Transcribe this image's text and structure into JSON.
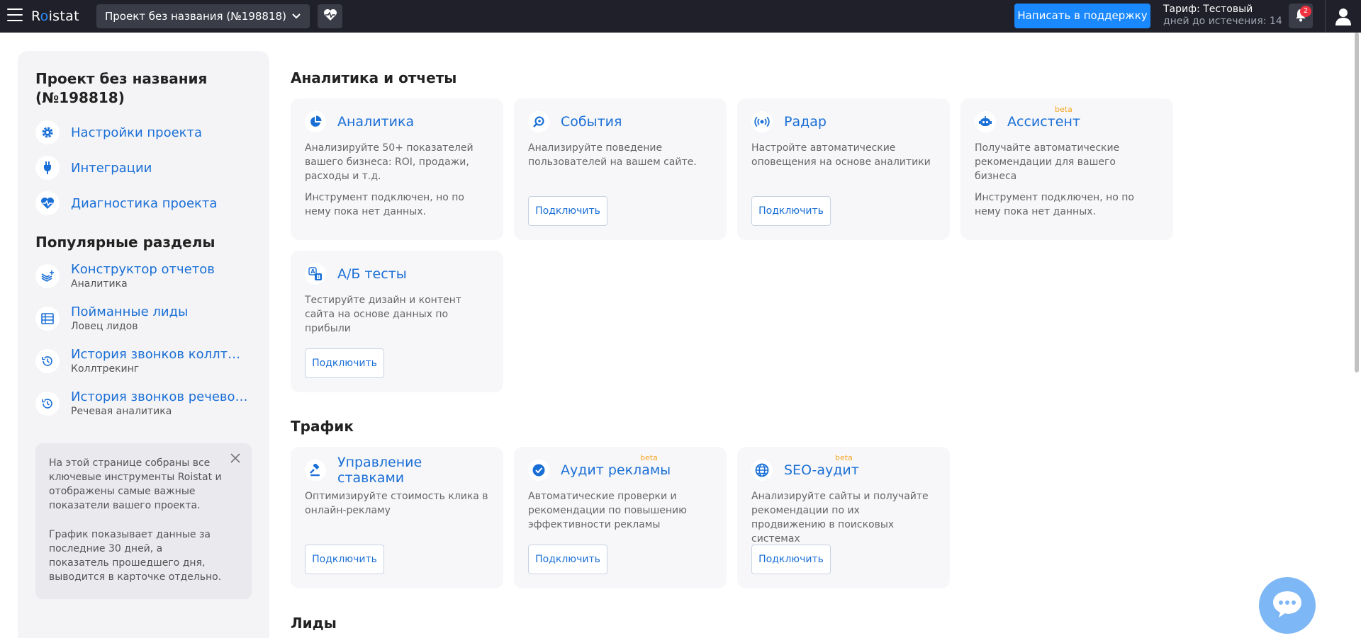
{
  "topbar": {
    "logo": "Roistat",
    "logo_prefix": "R",
    "logo_o": "o",
    "logo_suffix": "istat",
    "project_name": "Проект без названия (№198818)",
    "support_label": "Написать в поддержку",
    "tariff_label": "Тариф: Тестовый",
    "tariff_days": "дней до истечения: 14",
    "notifications_count": "2",
    "accent_color": "#1a88ff"
  },
  "sidebar": {
    "project_title": "Проект без названия (№198818)",
    "links": [
      {
        "label": "Настройки проекта",
        "icon": "gear-icon"
      },
      {
        "label": "Интеграции",
        "icon": "plug-icon"
      },
      {
        "label": "Диагностика проекта",
        "icon": "heart-pulse-icon"
      }
    ],
    "popular_title": "Популярные разделы",
    "popular": [
      {
        "label": "Конструктор отчетов",
        "sub": "Аналитика",
        "icon": "layers-plus-icon"
      },
      {
        "label": "Пойманные лиды",
        "sub": "Ловец лидов",
        "icon": "table-icon"
      },
      {
        "label": "История звонков коллтрекинга",
        "sub": "Коллтрекинг",
        "icon": "history-icon"
      },
      {
        "label": "История звонков речевой аналитики",
        "sub": "Речевая аналитика",
        "icon": "history-icon"
      }
    ],
    "info": {
      "p1": "На этой странице собраны все ключевые инструменты Roistat и отображены самые важные показатели вашего проекта.",
      "p2": "График показывает данные за последние 30 дней, а показатель прошедшего дня, выводится в карточке отдельно."
    }
  },
  "sections": {
    "analytics": "Аналитика и отчеты",
    "traffic": "Трафик",
    "leads": "Лиды"
  },
  "cards": {
    "analytics": {
      "title": "Аналитика",
      "desc": "Анализируйте 50+ показателей вашего бизнеса: ROI, продажи, расходы и т.д.",
      "note": "Инструмент подключен, но по нему пока нет данных."
    },
    "events": {
      "title": "События",
      "desc": "Анализируйте поведение пользователей на вашем сайте.",
      "button": "Подключить"
    },
    "radar": {
      "title": "Радар",
      "desc": "Настройте автоматические оповещения на основе аналитики",
      "button": "Подключить"
    },
    "assistant": {
      "title": "Ассистент",
      "beta": "beta",
      "desc": "Получайте автоматические рекомендации для вашего бизнеса",
      "note": "Инструмент подключен, но по нему пока нет данных."
    },
    "ab": {
      "title": "А/Б тесты",
      "desc": "Тестируйте дизайн и контент сайта на основе данных по прибыли",
      "button": "Подключить"
    },
    "bids": {
      "title": "Управление ставками",
      "desc": "Оптимизируйте стоимость клика в онлайн-рекламу",
      "button": "Подключить"
    },
    "audit": {
      "title": "Аудит рекламы",
      "beta": "beta",
      "desc": "Автоматические проверки и рекомендации по повышению эффективности рекламы",
      "button": "Подключить"
    },
    "seo": {
      "title": "SEO-аудит",
      "beta": "beta",
      "desc": "Анализируйте сайты и получайте рекомендации по их продвижению в поисковых системах",
      "button": "Подключить"
    }
  }
}
